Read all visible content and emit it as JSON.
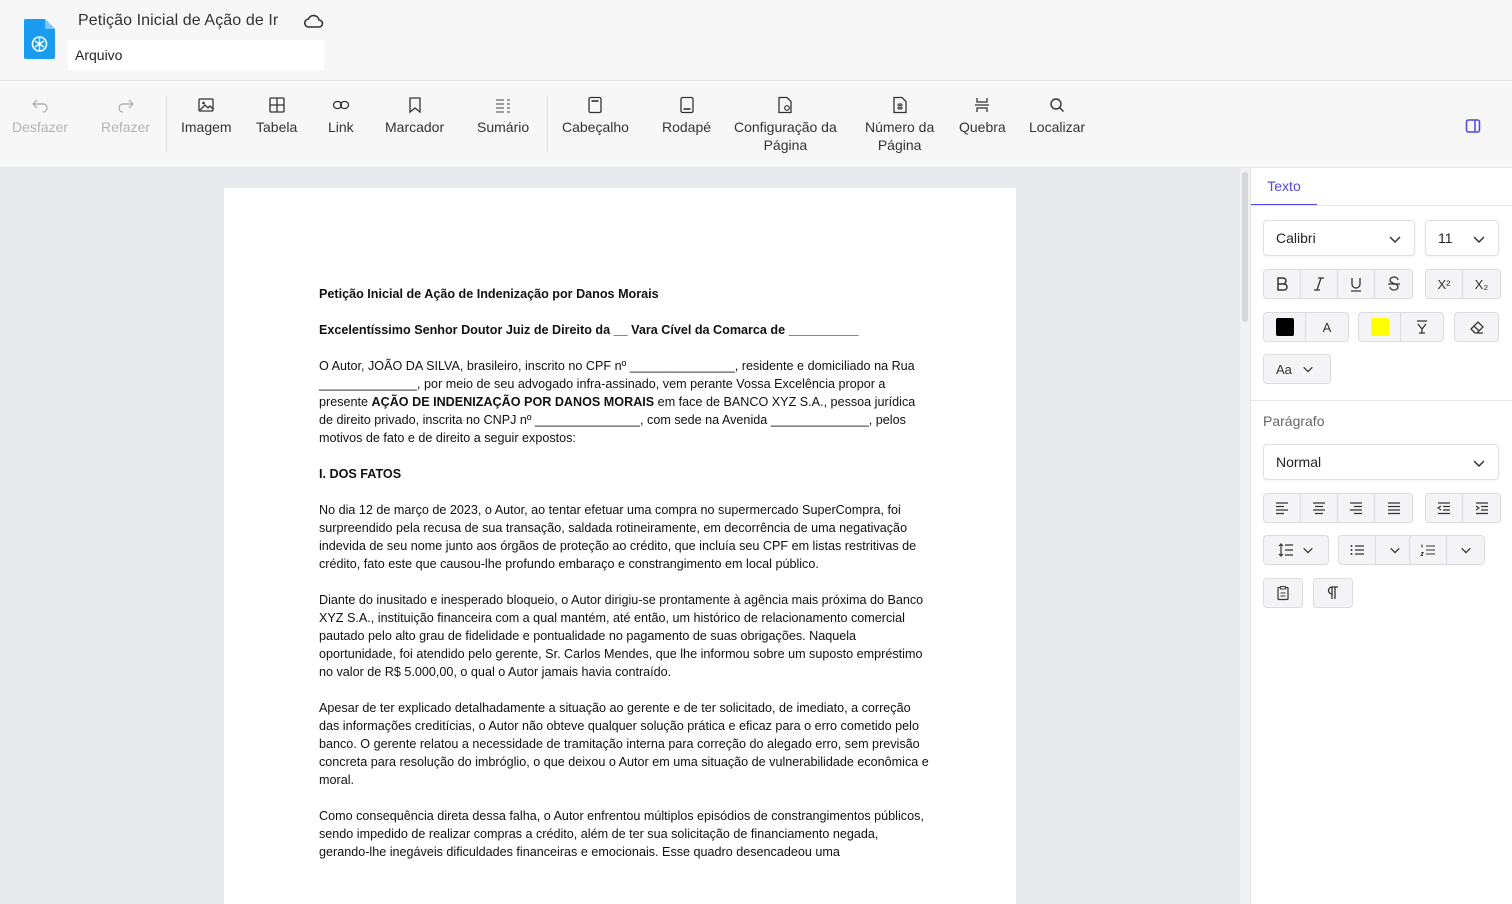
{
  "header": {
    "title": "Petição Inicial de Ação de Ir",
    "menu": [
      "Arquivo"
    ]
  },
  "toolbar": {
    "undo": "Desfazer",
    "redo": "Refazer",
    "image": "Imagem",
    "table": "Tabela",
    "link": "Link",
    "bookmark": "Marcador",
    "toc": "Sumário",
    "header": "Cabeçalho",
    "footer": "Rodapé",
    "page_setup_1": "Configuração da",
    "page_setup_2": "Página",
    "page_number_1": "Número da",
    "page_number_2": "Página",
    "break": "Quebra",
    "find": "Localizar"
  },
  "document": {
    "title": "Petição Inicial de Ação de Indenização por Danos Morais",
    "addressee": "Excelentíssimo Senhor Doutor Juiz de Direito da __ Vara Cível da Comarca de __________",
    "intro_a": "O Autor, JOÃO DA SILVA, brasileiro, inscrito no CPF nº _______________, residente e domiciliado na Rua ______________, por meio de seu advogado infra-assinado, vem perante Vossa Excelência propor a presente ",
    "intro_bold": "AÇÃO DE INDENIZAÇÃO POR DANOS MORAIS",
    "intro_b": " em face de BANCO XYZ S.A., pessoa jurídica de direito privado, inscrita no CNPJ nº _______________, com sede na Avenida ______________, pelos motivos de fato e de direito a seguir expostos:",
    "section1": "I. DOS FATOS",
    "p1": "No dia 12 de março de 2023, o Autor, ao tentar efetuar uma compra no supermercado SuperCompra, foi surpreendido pela recusa de sua transação, saldada rotineiramente, em decorrência de uma negativação indevida de seu nome junto aos órgãos de proteção ao crédito, que incluía seu CPF em listas restritivas de crédito, fato este que causou-lhe profundo embaraço e constrangimento em local público.",
    "p2": "Diante do inusitado e inesperado bloqueio, o Autor dirigiu-se prontamente à agência mais próxima do Banco XYZ S.A., instituição financeira com a qual mantém, até então, um histórico de relacionamento comercial pautado pelo alto grau de fidelidade e pontualidade no pagamento de suas obrigações. Naquela oportunidade, foi atendido pelo gerente, Sr. Carlos Mendes, que lhe informou sobre um suposto empréstimo no valor de R$ 5.000,00, o qual o Autor jamais havia contraído.",
    "p3": "Apesar de ter explicado detalhadamente a situação ao gerente e de ter solicitado, de imediato, a correção das informações creditícias, o Autor não obteve qualquer solução prática e eficaz para o erro cometido pelo banco. O gerente relatou a necessidade de tramitação interna para correção do alegado erro, sem previsão concreta para resolução do imbróglio, o que deixou o Autor em uma situação de vulnerabilidade econômica e moral.",
    "p4": "Como consequência direta dessa falha, o Autor enfrentou múltiplos episódios de constrangimentos públicos, sendo impedido de realizar compras a crédito, além de ter sua solicitação de financiamento negada, gerando-lhe inegáveis dificuldades financeiras e emocionais. Esse quadro desencadeou uma"
  },
  "panel": {
    "tab": "Texto",
    "font": "Calibri",
    "size": "11",
    "superscript": "X²",
    "subscript": "X₂",
    "font_color_letter": "A",
    "case_btn": "Aa",
    "paragraph_label": "Parágrafo",
    "paragraph_style": "Normal",
    "colors": {
      "font_color": "#000000",
      "highlight": "#ffff00",
      "accent": "#4f46e5"
    }
  }
}
